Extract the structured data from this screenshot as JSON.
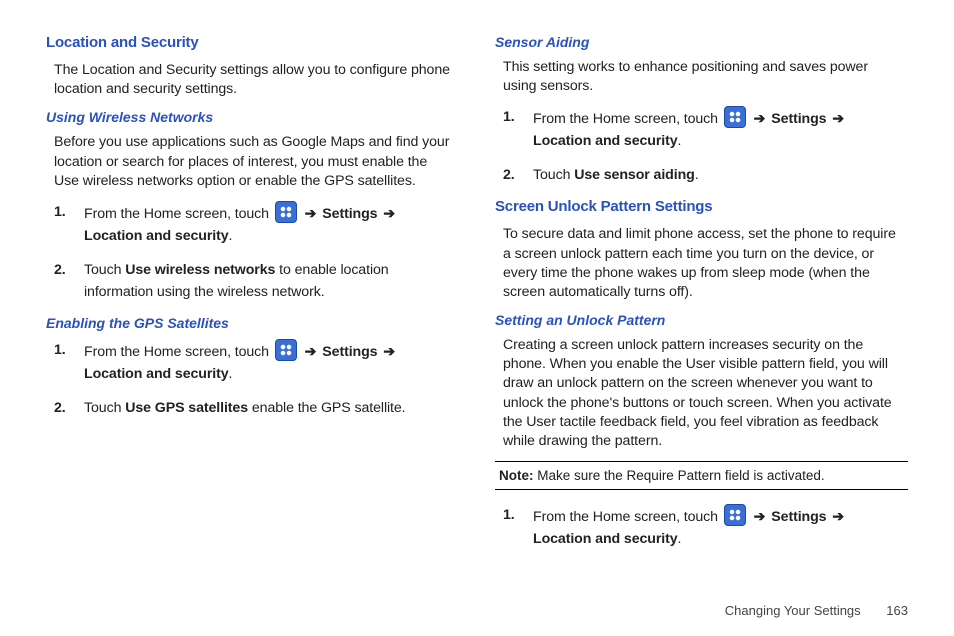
{
  "left": {
    "h1": "Location and Security",
    "p1": "The Location and Security settings allow you to configure phone location and security settings.",
    "sub1": "Using Wireless Networks",
    "p2": "Before you use applications such as Google Maps and find your location or search for places of interest, you must enable the Use wireless networks option or enable the GPS satellites.",
    "step1_pre": "From the Home screen, touch ",
    "step1_nav1": "Settings",
    "step1_nav2": "Location and security",
    "step2_pre": "Touch ",
    "step2_bold": "Use wireless networks",
    "step2_post": " to enable location information using the wireless network.",
    "sub2": "Enabling the GPS Satellites",
    "g_step1_pre": "From the Home screen, touch ",
    "g_step1_nav1": "Settings",
    "g_step1_nav2": "Location and security",
    "g_step2_pre": "Touch ",
    "g_step2_bold": "Use GPS satellites",
    "g_step2_post": " enable the GPS satellite."
  },
  "right": {
    "sub1": "Sensor Aiding",
    "p1": "This setting works to enhance positioning and saves power using sensors.",
    "s_step1_pre": "From the Home screen, touch ",
    "s_step1_nav1": "Settings",
    "s_step1_nav2": "Location and security",
    "s_step2_pre": "Touch ",
    "s_step2_bold": "Use sensor aiding",
    "h2": "Screen Unlock Pattern Settings",
    "p2": "To secure data and limit phone access, set the phone to require a screen unlock pattern each time you turn on the device, or every time the phone wakes up from sleep mode (when the screen automatically turns off).",
    "sub2": "Setting an Unlock Pattern",
    "p3": "Creating a screen unlock pattern increases security on the phone. When you enable the User visible pattern field, you will draw an unlock pattern on the screen whenever you want to unlock the phone's buttons or touch screen. When you activate the User tactile feedback field, you feel vibration as feedback while drawing the pattern.",
    "note_label": "Note:",
    "note_text": " Make sure the Require Pattern field is activated.",
    "u_step1_pre": "From the Home screen, touch ",
    "u_step1_nav1": "Settings",
    "u_step1_nav2": "Location and security"
  },
  "footer": {
    "section": "Changing Your Settings",
    "page": "163"
  },
  "arrow": "➔",
  "period": "."
}
